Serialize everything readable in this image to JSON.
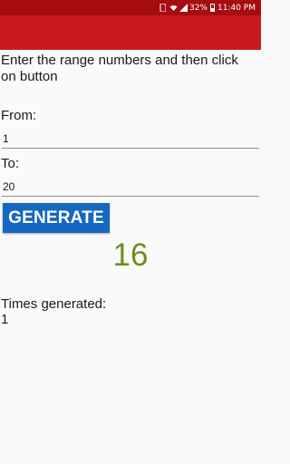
{
  "status_bar": {
    "battery": "32%",
    "time": "11:40 PM",
    "icons": [
      "sim-icon",
      "wifi-icon",
      "signal-icon",
      "battery-icon"
    ]
  },
  "instructions": "Enter the range numbers and then click on button",
  "from": {
    "label": "From:",
    "value": "1"
  },
  "to": {
    "label": "To:",
    "value": "20"
  },
  "generate_button": "GENERATE",
  "result": "16",
  "times_generated": {
    "label": "Times generated:",
    "count": "1"
  },
  "colors": {
    "status_bar": "#a50d10",
    "app_bar": "#c81a1f",
    "button": "#1568c1",
    "result": "#6b8f1c"
  }
}
